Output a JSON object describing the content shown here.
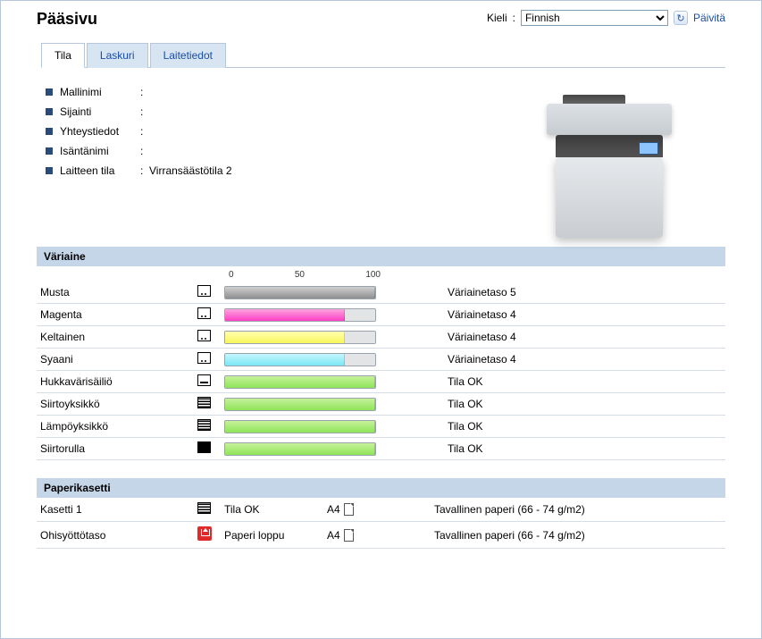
{
  "header": {
    "title": "Pääsivu",
    "lang_label": "Kieli",
    "lang_value": "Finnish",
    "refresh_label": "Päivitä"
  },
  "tabs": [
    {
      "label": "Tila",
      "active": true
    },
    {
      "label": "Laskuri",
      "active": false
    },
    {
      "label": "Laitetiedot",
      "active": false
    }
  ],
  "info": [
    {
      "label": "Mallinimi",
      "value": ""
    },
    {
      "label": "Sijainti",
      "value": ""
    },
    {
      "label": "Yhteystiedot",
      "value": ""
    },
    {
      "label": "Isäntänimi",
      "value": ""
    },
    {
      "label": "Laitteen tila",
      "value": "Virransäästötila 2"
    }
  ],
  "toner_section_title": "Väriaine",
  "scale": {
    "min": "0",
    "mid": "50",
    "max": "100"
  },
  "supplies": [
    {
      "name": "Musta",
      "kind": "toner",
      "color": "gray",
      "pct": 100,
      "status": "Väriainetaso 5"
    },
    {
      "name": "Magenta",
      "kind": "toner",
      "color": "magenta",
      "pct": 80,
      "status": "Väriainetaso 4"
    },
    {
      "name": "Keltainen",
      "kind": "toner",
      "color": "yellow",
      "pct": 80,
      "status": "Väriainetaso 4"
    },
    {
      "name": "Syaani",
      "kind": "toner",
      "color": "cyan",
      "pct": 80,
      "status": "Väriainetaso 4"
    },
    {
      "name": "Hukkavärisäiliö",
      "kind": "waste",
      "color": "green",
      "pct": 100,
      "status": "Tila OK"
    },
    {
      "name": "Siirtoyksikkö",
      "kind": "unit",
      "color": "green",
      "pct": 100,
      "status": "Tila OK"
    },
    {
      "name": "Lämpöyksikkö",
      "kind": "unit",
      "color": "green",
      "pct": 100,
      "status": "Tila OK"
    },
    {
      "name": "Siirtorulla",
      "kind": "unit",
      "color": "green",
      "pct": 100,
      "status": "Tila OK"
    }
  ],
  "tray_section_title": "Paperikasetti",
  "trays": [
    {
      "name": "Kasetti 1",
      "icon": "ok",
      "status": "Tila OK",
      "size": "A4",
      "type": "Tavallinen paperi (66 - 74 g/m2)"
    },
    {
      "name": "Ohisyöttötaso",
      "icon": "error",
      "status": "Paperi loppu",
      "size": "A4",
      "type": "Tavallinen paperi (66 - 74 g/m2)"
    }
  ]
}
